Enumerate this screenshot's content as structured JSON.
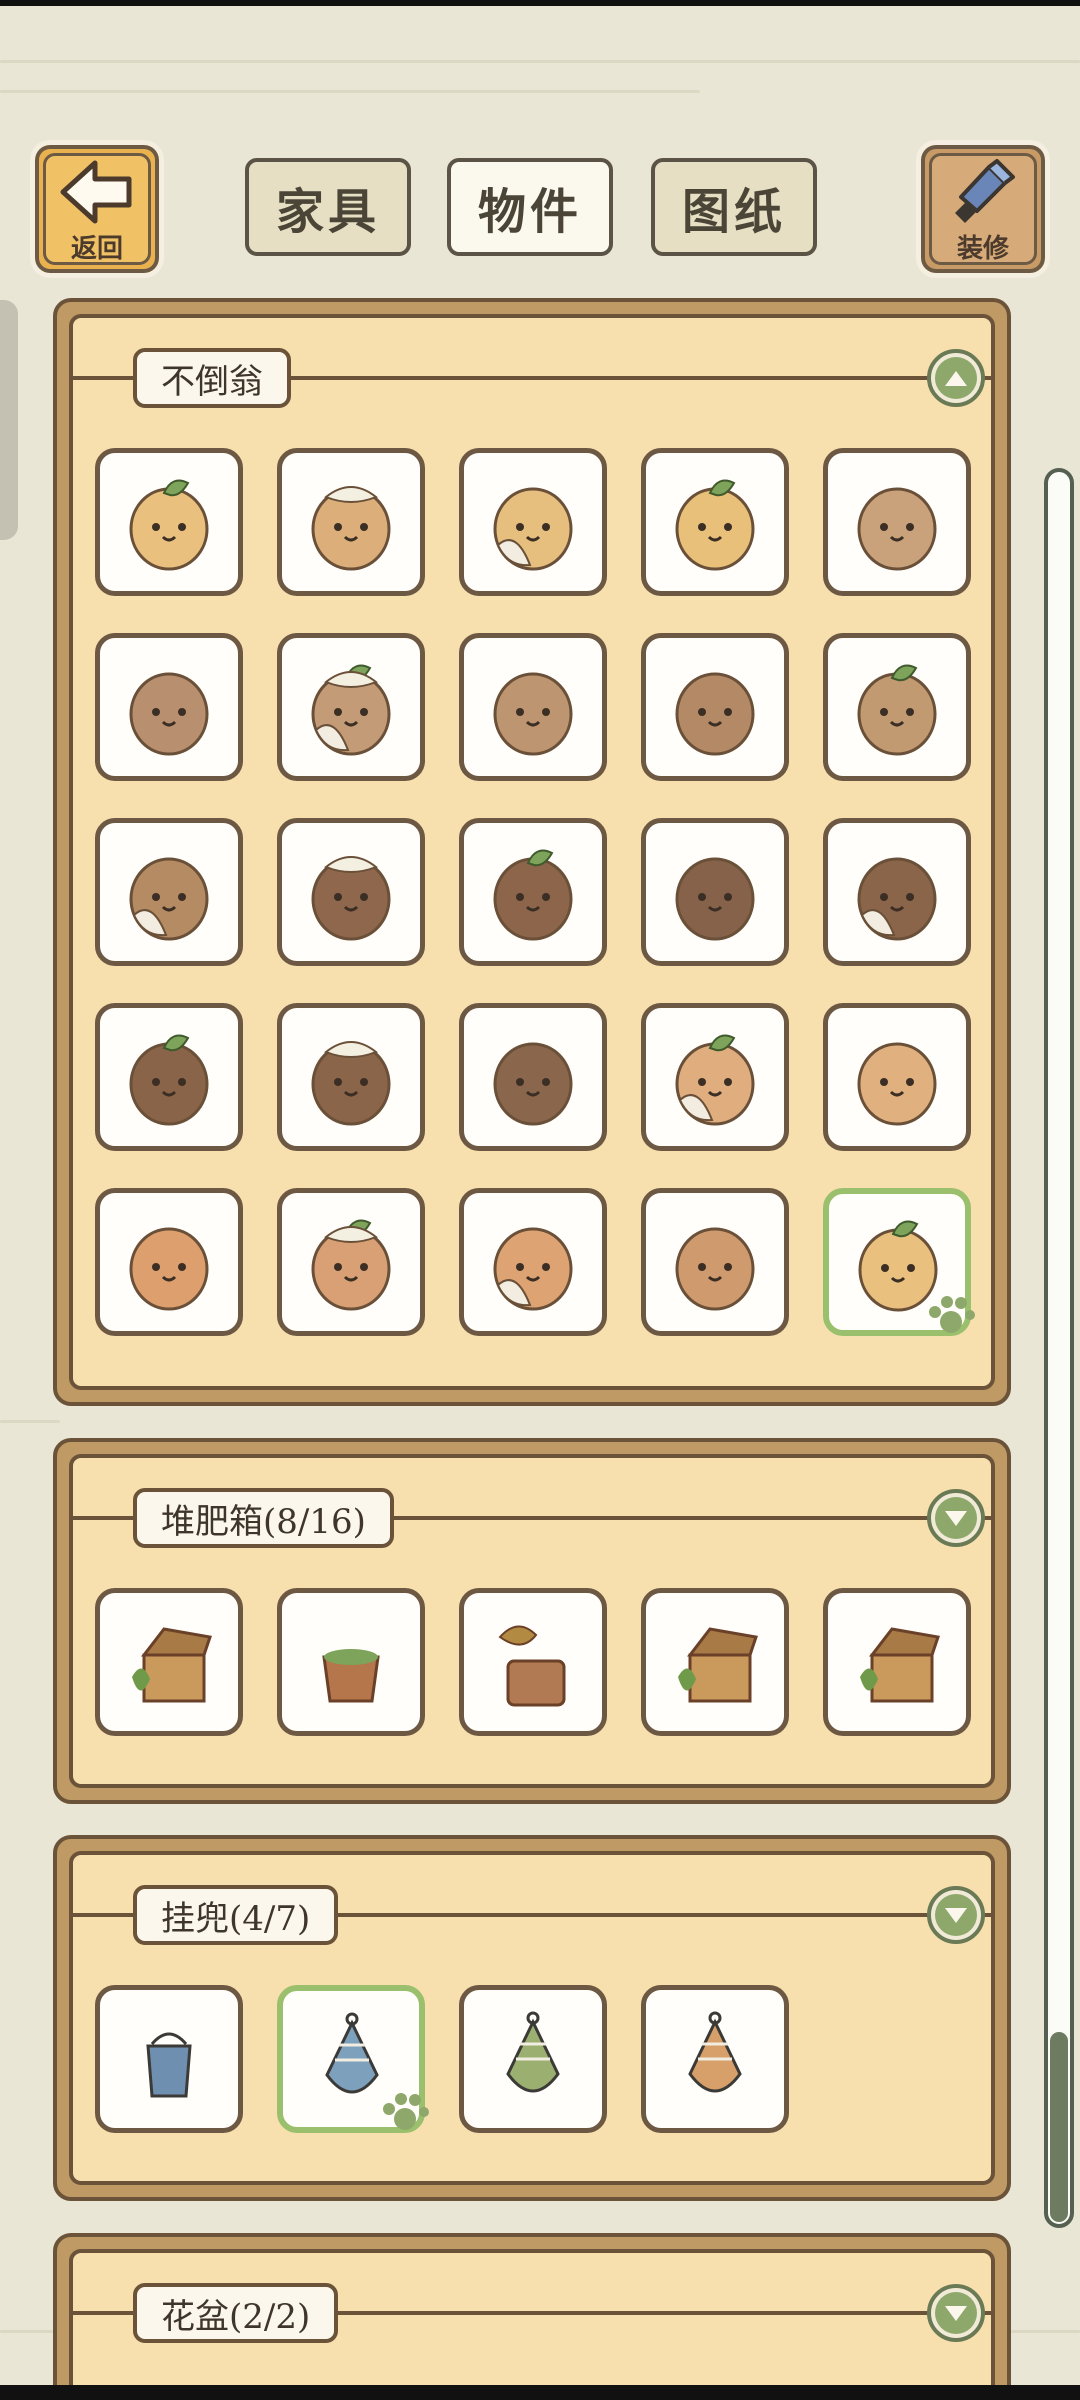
{
  "header": {
    "back_label": "返回",
    "decor_label": "装修",
    "tabs": [
      {
        "label": "家具",
        "active": false
      },
      {
        "label": "物件",
        "active": true
      },
      {
        "label": "图纸",
        "active": false
      }
    ]
  },
  "sections": [
    {
      "title": "不倒翁",
      "state": "expanded",
      "toggle_icon": "chevron-up-icon"
    },
    {
      "title": "堆肥箱(8/16)",
      "state": "collapsed",
      "toggle_icon": "chevron-down-icon"
    },
    {
      "title": "挂兜(4/7)",
      "state": "collapsed",
      "toggle_icon": "chevron-down-icon"
    },
    {
      "title": "花盆(2/2)",
      "state": "collapsed",
      "toggle_icon": "chevron-down-icon"
    }
  ],
  "colors": {
    "background": "#e9e6d6",
    "panel": "#f7dfae",
    "frame": "#c09a64",
    "outline": "#6b5339",
    "accent_green": "#8ea86b",
    "back_button": "#e9b24e"
  }
}
